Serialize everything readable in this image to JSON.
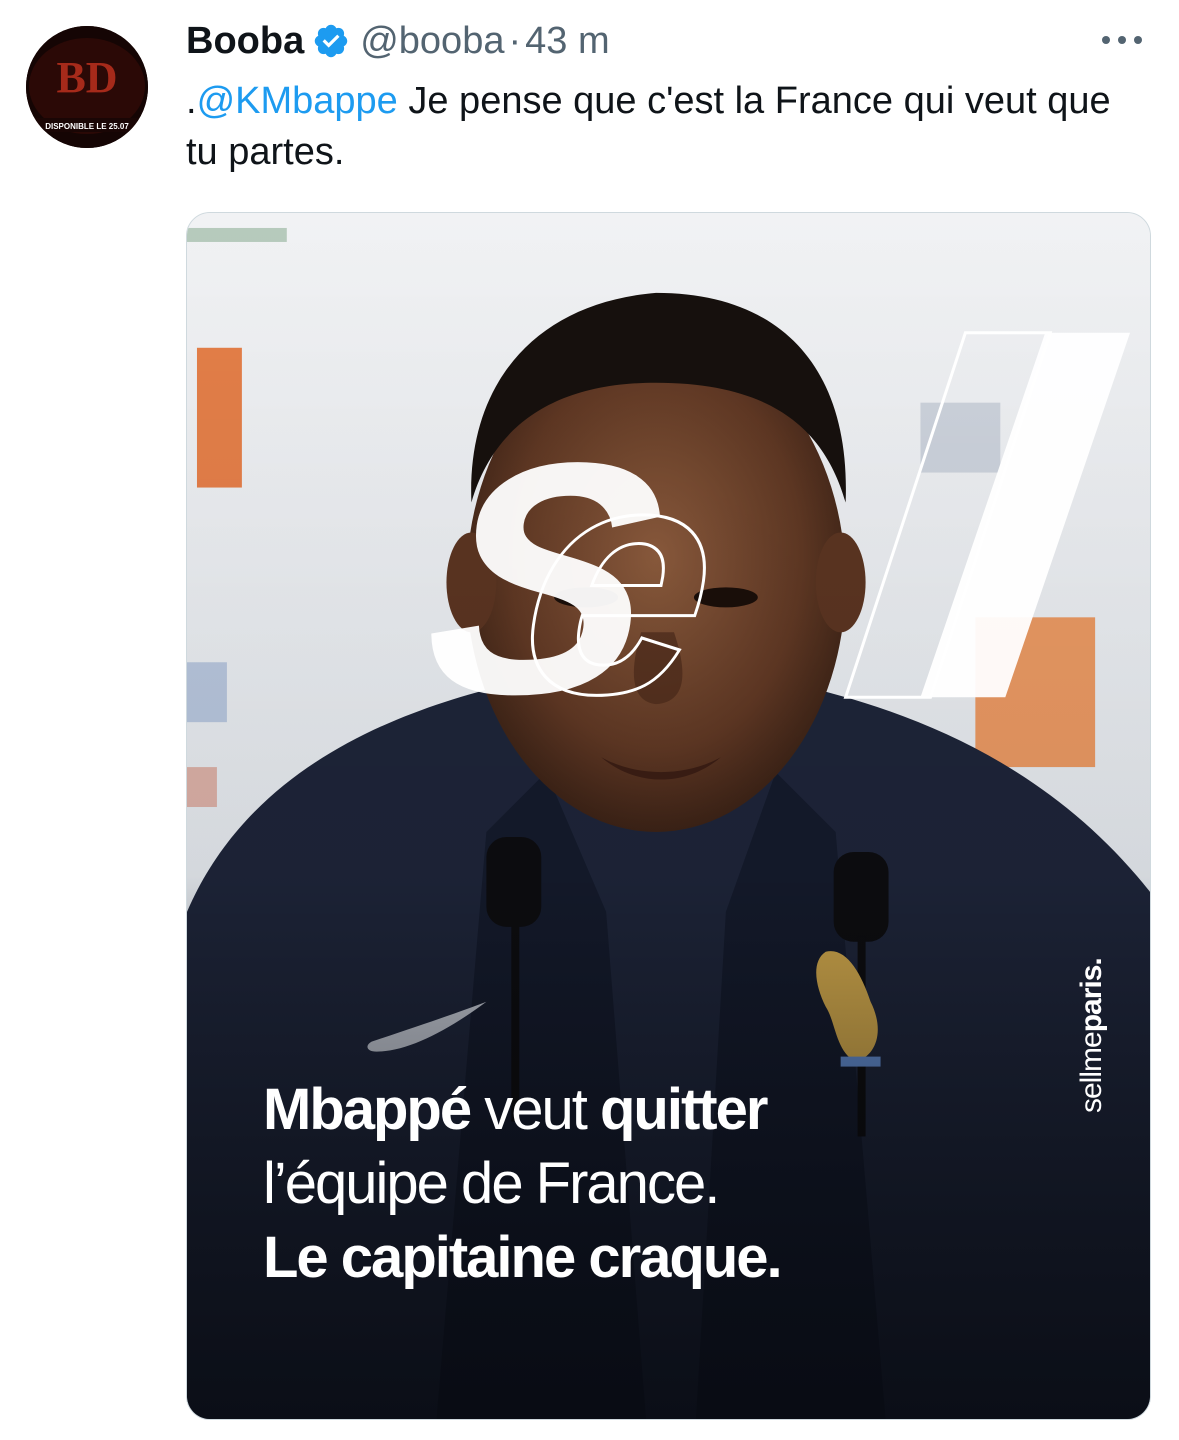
{
  "tweet": {
    "display_name": "Booba",
    "handle": "@booba",
    "separator": "·",
    "time": "43 m",
    "text_prefix": ".",
    "mention": "@KMbappe",
    "text_body": " Je pense que c'est la France qui veut que tu partes."
  },
  "avatar": {
    "logo_text": "BD",
    "banner_text": "DISPONIBLE LE 25.07"
  },
  "media": {
    "overlay_logo": "Sell",
    "watermark_light": "sellme",
    "watermark_bold": "paris.",
    "caption": {
      "line1_bold_a": "Mbappé",
      "line1_light": " veut ",
      "line1_bold_b": "quitter",
      "line2": "l’équipe de France.",
      "line3": "Le capitaine craque."
    }
  },
  "colors": {
    "text": "#0f1419",
    "secondary": "#536471",
    "link": "#1d9bf0",
    "verified": "#1d9bf0"
  },
  "icons": {
    "verified": "verified-badge-icon",
    "more": "more-dots-icon"
  }
}
